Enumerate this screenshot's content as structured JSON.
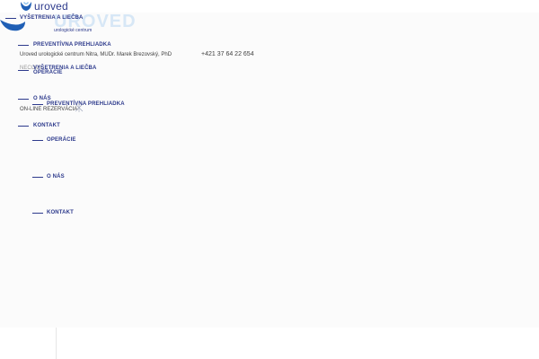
{
  "brand": {
    "small_logo_text": "uroved",
    "big_logo_text": "UROVED",
    "big_logo_sub": "urologické centrum",
    "accent_color": "#2d3a8c",
    "light_logo_color": "#d7e7f6"
  },
  "top_nav": {
    "items": [
      {
        "label": "VYŠETRENIA A LIEČBA"
      }
    ]
  },
  "header": {
    "practice_info": "Uroved urologické centrum Nitra, MUDr. Marek Brezovský, PhD",
    "phone": "+421 37 64 22 654",
    "reservation_label": "ON-LINE REZERVÁCIA",
    "cut_label": "NECOVY"
  },
  "menu_left": {
    "items": [
      {
        "label": "PREVENTÍVNA PREHLIADKA"
      },
      {
        "label": "VYŠETRENIA A LIEČBA"
      },
      {
        "label": "OPERÁCIE"
      },
      {
        "label": "O NÁS"
      },
      {
        "label": "PREVENTÍVNA PREHLIADKA"
      },
      {
        "label": "KONTAKT"
      }
    ]
  },
  "menu_right": {
    "items": [
      {
        "label": "OPERÁCIE"
      },
      {
        "label": "O NÁS"
      },
      {
        "label": "KONTAKT"
      }
    ]
  },
  "icons": [
    "logo-mark",
    "close-icon"
  ]
}
